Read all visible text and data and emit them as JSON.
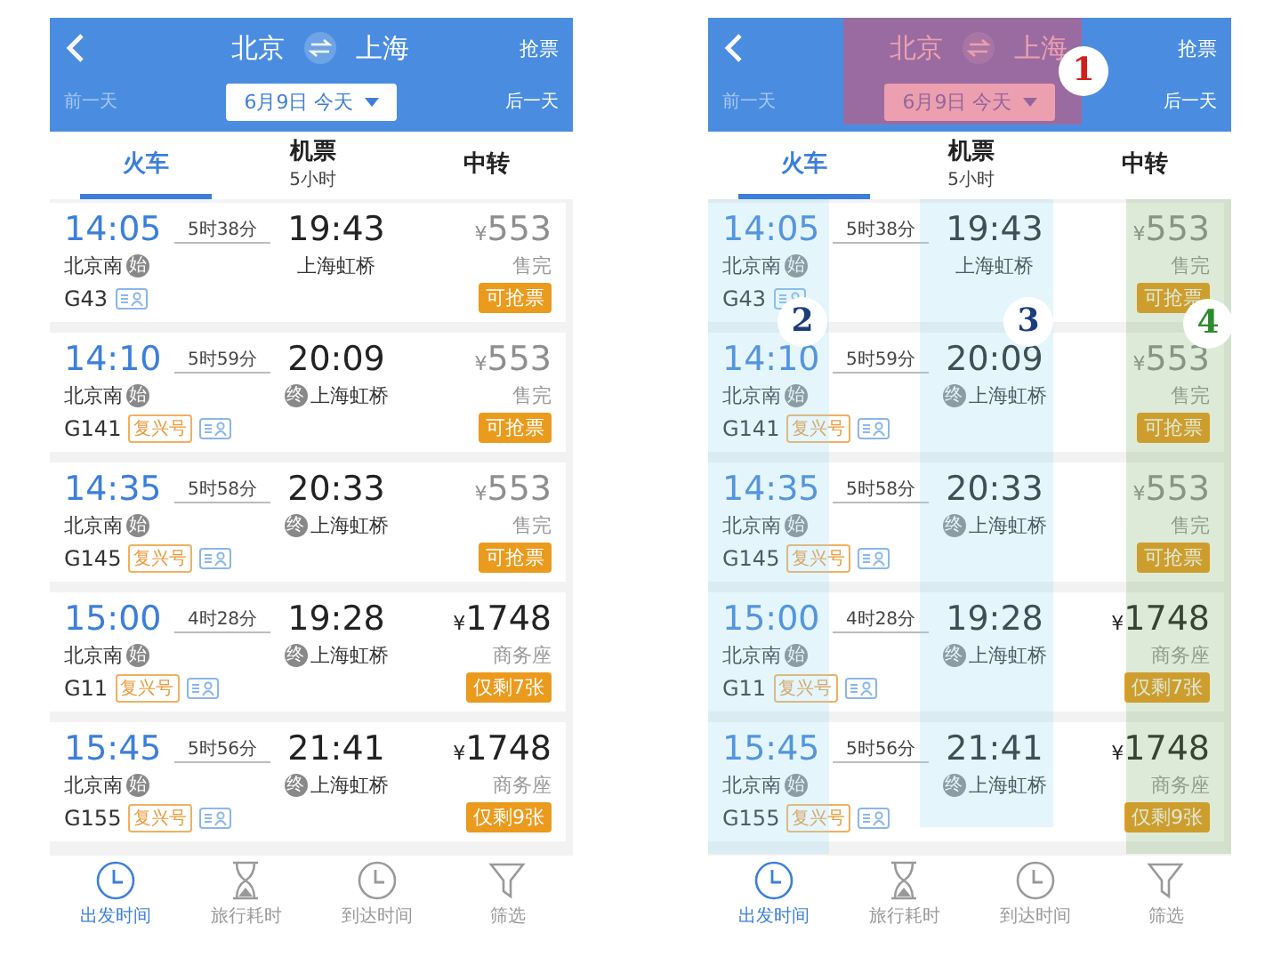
{
  "screens": [
    {
      "header": {
        "from": "北京",
        "to": "上海",
        "action": "抢票",
        "prev": "前一天",
        "next": "后一天",
        "date": "6月9日 今天"
      },
      "tabs": [
        {
          "label": "火车",
          "selected": true
        },
        {
          "label": "机票",
          "sub": "5小时",
          "selected": false
        },
        {
          "label": "中转",
          "selected": false
        }
      ],
      "trains": [
        {
          "depart": "14:05",
          "duration": "5时38分",
          "arrive": "19:43",
          "from": "北京南",
          "from_badge": "始",
          "to": "上海虹桥",
          "number": "G43",
          "currency": "¥",
          "price": "553",
          "available": false,
          "seat": "售完",
          "status": "可抢票"
        },
        {
          "depart": "14:10",
          "duration": "5时59分",
          "arrive": "20:09",
          "from": "北京南",
          "from_badge": "始",
          "to": "上海虹桥",
          "to_badge": "终",
          "number": "G141",
          "tag": "复兴号",
          "currency": "¥",
          "price": "553",
          "available": false,
          "seat": "售完",
          "status": "可抢票"
        },
        {
          "depart": "14:35",
          "duration": "5时58分",
          "arrive": "20:33",
          "from": "北京南",
          "from_badge": "始",
          "to": "上海虹桥",
          "to_badge": "终",
          "number": "G145",
          "tag": "复兴号",
          "currency": "¥",
          "price": "553",
          "available": false,
          "seat": "售完",
          "status": "可抢票"
        },
        {
          "depart": "15:00",
          "duration": "4时28分",
          "arrive": "19:28",
          "from": "北京南",
          "from_badge": "始",
          "to": "上海虹桥",
          "to_badge": "终",
          "number": "G11",
          "tag": "复兴号",
          "currency": "¥",
          "price": "1748",
          "available": true,
          "seat": "商务座",
          "status": "仅剩7张"
        },
        {
          "depart": "15:45",
          "duration": "5时56分",
          "arrive": "21:41",
          "from": "北京南",
          "from_badge": "始",
          "to": "上海虹桥",
          "to_badge": "终",
          "number": "G155",
          "tag": "复兴号",
          "currency": "¥",
          "price": "1748",
          "available": true,
          "seat": "商务座",
          "status": "仅剩9张"
        }
      ],
      "bottom_bar": [
        {
          "label": "出发时间",
          "kind": "clock",
          "selected": true
        },
        {
          "label": "旅行耗时",
          "kind": "hourglass",
          "selected": false
        },
        {
          "label": "到达时间",
          "kind": "clock",
          "selected": false
        },
        {
          "label": "筛选",
          "kind": "filter",
          "selected": false
        }
      ]
    },
    {
      "header": {
        "from": "北京",
        "to": "上海",
        "action": "抢票",
        "prev": "前一天",
        "next": "后一天",
        "date": "6月9日 今天"
      },
      "tabs": [
        {
          "label": "火车",
          "selected": true
        },
        {
          "label": "机票",
          "sub": "5小时",
          "selected": false
        },
        {
          "label": "中转",
          "selected": false
        }
      ],
      "trains": [
        {
          "depart": "14:05",
          "duration": "5时38分",
          "arrive": "19:43",
          "from": "北京南",
          "from_badge": "始",
          "to": "上海虹桥",
          "number": "G43",
          "currency": "¥",
          "price": "553",
          "available": false,
          "seat": "售完",
          "status": "可抢票"
        },
        {
          "depart": "14:10",
          "duration": "5时59分",
          "arrive": "20:09",
          "from": "北京南",
          "from_badge": "始",
          "to": "上海虹桥",
          "to_badge": "终",
          "number": "G141",
          "tag": "复兴号",
          "currency": "¥",
          "price": "553",
          "available": false,
          "seat": "售完",
          "status": "可抢票"
        },
        {
          "depart": "14:35",
          "duration": "5时58分",
          "arrive": "20:33",
          "from": "北京南",
          "from_badge": "始",
          "to": "上海虹桥",
          "to_badge": "终",
          "number": "G145",
          "tag": "复兴号",
          "currency": "¥",
          "price": "553",
          "available": false,
          "seat": "售完",
          "status": "可抢票"
        },
        {
          "depart": "15:00",
          "duration": "4时28分",
          "arrive": "19:28",
          "from": "北京南",
          "from_badge": "始",
          "to": "上海虹桥",
          "to_badge": "终",
          "number": "G11",
          "tag": "复兴号",
          "currency": "¥",
          "price": "1748",
          "available": true,
          "seat": "商务座",
          "status": "仅剩7张"
        },
        {
          "depart": "15:45",
          "duration": "5时56分",
          "arrive": "21:41",
          "from": "北京南",
          "from_badge": "始",
          "to": "上海虹桥",
          "to_badge": "终",
          "number": "G155",
          "tag": "复兴号",
          "currency": "¥",
          "price": "1748",
          "available": true,
          "seat": "商务座",
          "status": "仅剩9张"
        }
      ],
      "bottom_bar": [
        {
          "label": "出发时间",
          "kind": "clock",
          "selected": true
        },
        {
          "label": "旅行耗时",
          "kind": "hourglass",
          "selected": false
        },
        {
          "label": "到达时间",
          "kind": "clock",
          "selected": false
        },
        {
          "label": "筛选",
          "kind": "filter",
          "selected": false
        }
      ],
      "highlights": [
        {
          "kind": "header"
        },
        {
          "kind": "depart"
        },
        {
          "kind": "arrive"
        },
        {
          "kind": "price"
        }
      ],
      "markers": [
        {
          "label": "1",
          "color": "#d0201c"
        },
        {
          "label": "2",
          "color": "#1c3d7a"
        },
        {
          "label": "3",
          "color": "#1c3d7a"
        },
        {
          "label": "4",
          "color": "#2f8a2f"
        }
      ]
    }
  ]
}
